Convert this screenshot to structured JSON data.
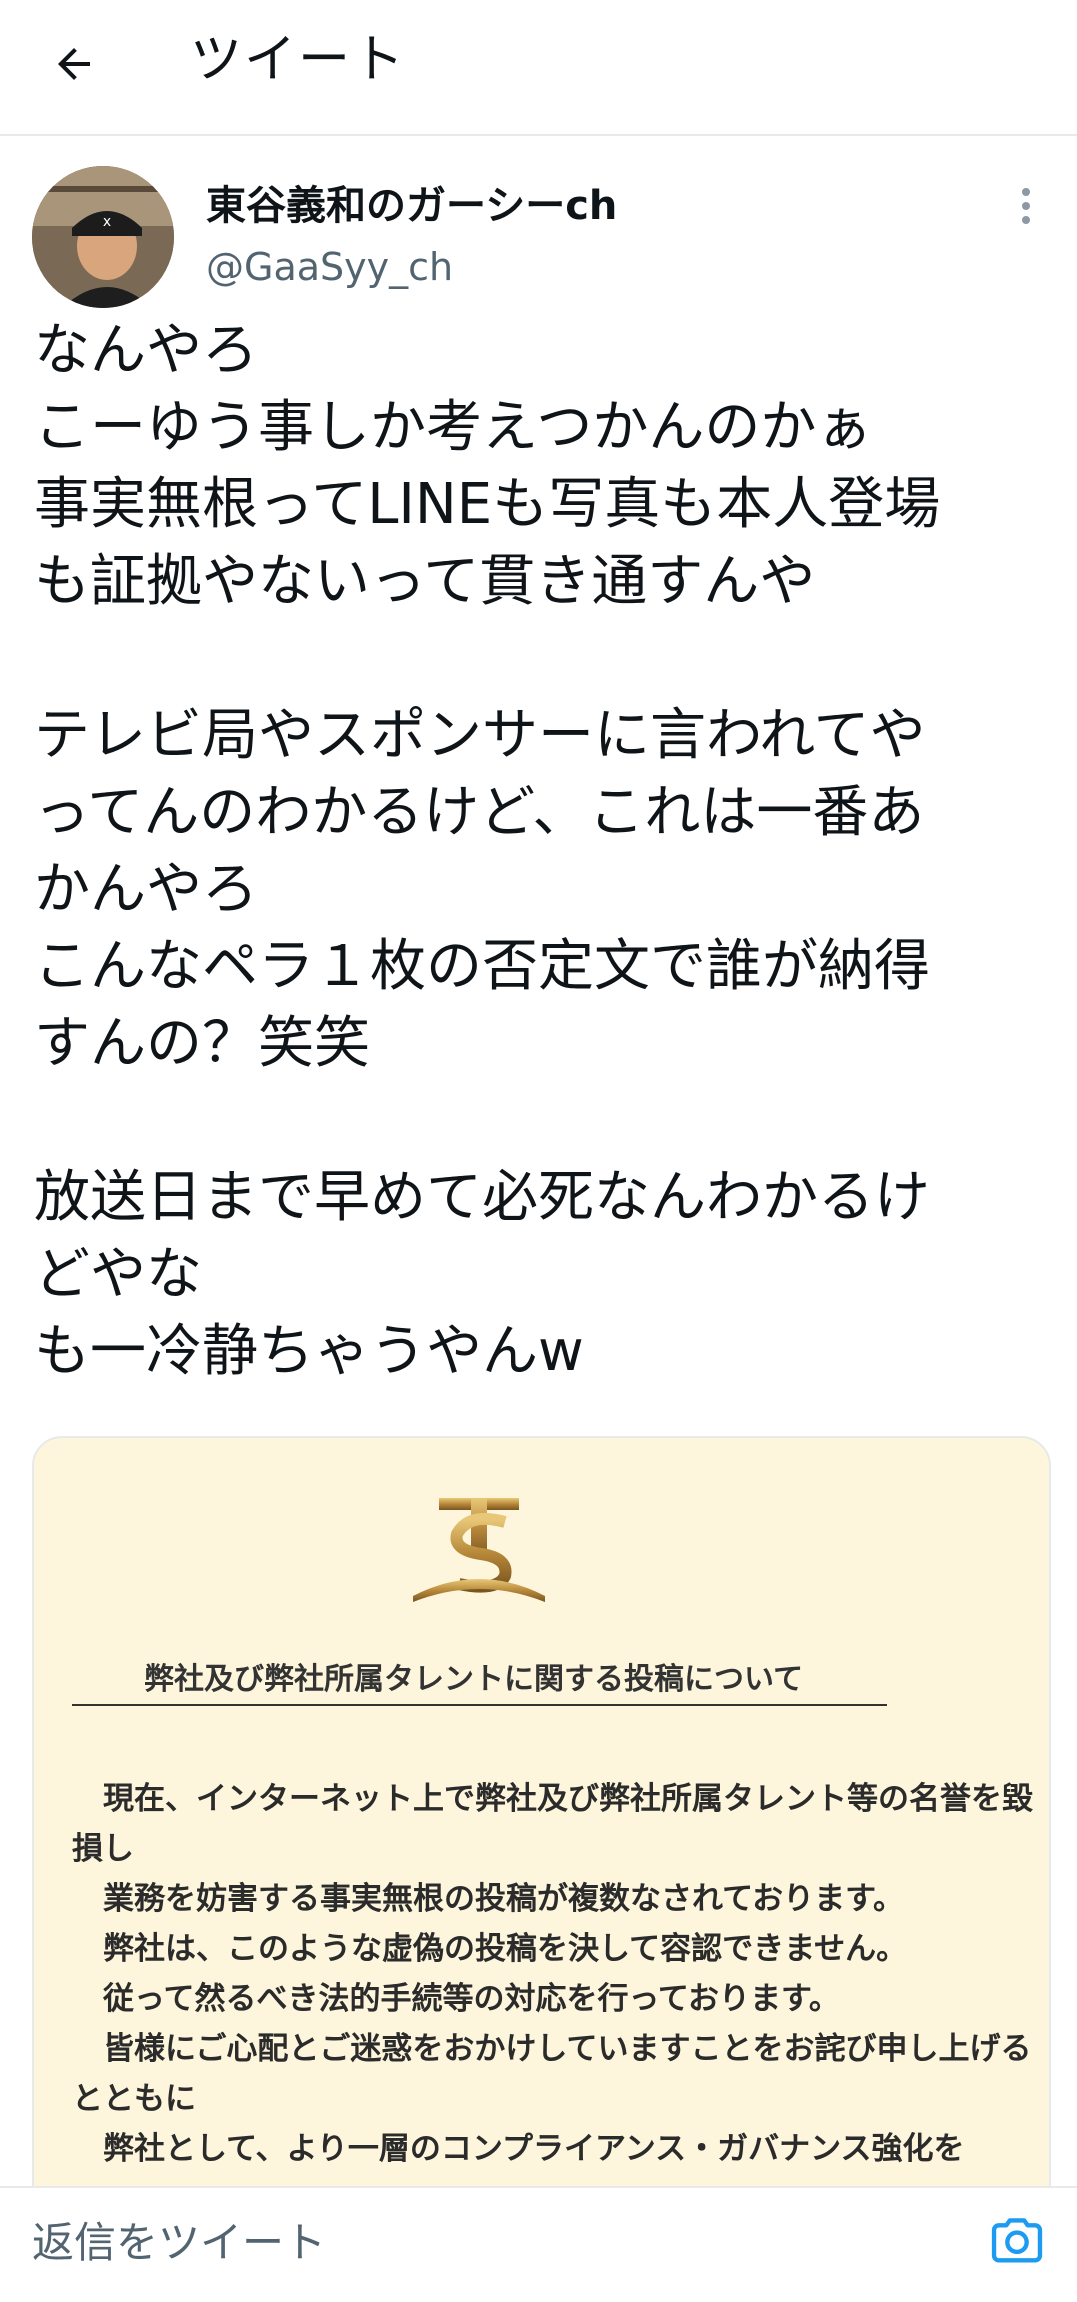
{
  "header": {
    "back_icon": "arrow-left-icon",
    "title": "ツイート"
  },
  "tweet": {
    "author": {
      "display_name": "東谷義和のガーシーch",
      "handle": "@GaaSyy_ch",
      "avatar_icon": "avatar-photo"
    },
    "more_icon": "vertical-dots-icon",
    "text": "なんやろ\nこーゆう事しか考えつかんのかぁ\n事実無根ってLINEも写真も本人登場\nも証拠やないって貫き通すんや\n\nテレビ局やスポンサーに言われてや\nってんのわかるけど、これは一番あ\nかんやろ\nこんなペラ１枚の否定文で誰が納得\nすんの？笑笑\n\n放送日まで早めて必死なんわかるけ\nどやな\nも一冷静ちゃうやんw",
    "media": {
      "logo_icon": "company-logo",
      "notice_title": "弊社及び弊社所属タレントに関する投稿について",
      "paragraphs": [
        "　現在、インターネット上で弊社及び弊社所属タレント等の名誉を毀損し",
        "　業務を妨害する事実無根の投稿が複数なされております。",
        "　弊社は、このような虚偽の投稿を決して容認できません。",
        "　従って然るべき法的手続等の対応を行っております。",
        "　皆様にご心配とご迷惑をおかけしていますことをお詫び申し上げるとともに",
        "　弊社として、より一層のコンプライアンス・ガバナンス強化を"
      ],
      "background_color": "#fdf6dc"
    }
  },
  "reply_bar": {
    "placeholder": "返信をツイート",
    "camera_icon": "camera-icon",
    "accent_color": "#1d9bf0"
  }
}
